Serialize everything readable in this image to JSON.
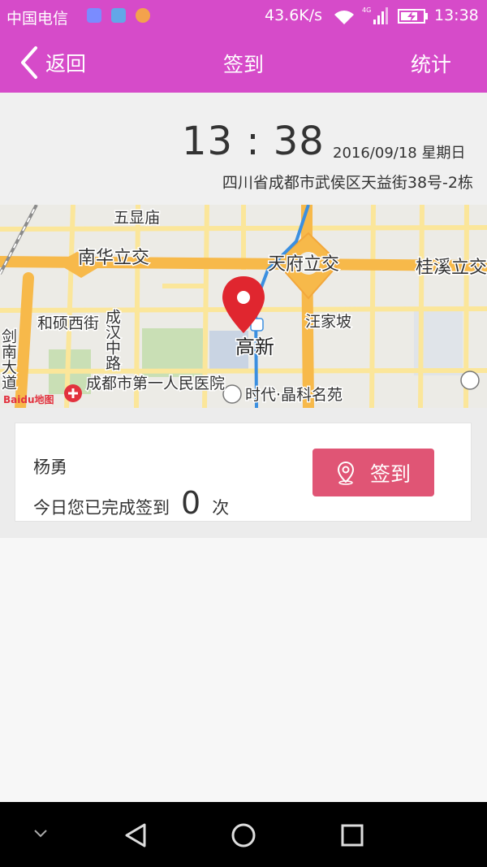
{
  "status_bar": {
    "carrier": "中国电信",
    "speed": "43.6K/s",
    "network": "4G",
    "time": "13:38"
  },
  "header": {
    "back_label": "返回",
    "title": "签到",
    "right_action": "统计"
  },
  "clock": {
    "time": "13 : 38",
    "date": "2016/09/18  星期日",
    "address": "四川省成都市武侯区天益街38号-2栋"
  },
  "map": {
    "labels": {
      "wuxianmiao": "五显庙",
      "nanhua": "南华立交",
      "tianfu": "天府立交",
      "guixi": "桂溪立交",
      "heshuo": "和硕西街",
      "chenghan": "成汉中路",
      "jiannan": "剑南大道",
      "wangjiapo": "汪家坡",
      "gaoxin": "高新",
      "hospital": "成都市第一人民医院",
      "shidai": "时代·晶科名苑",
      "baidu": "Baidu地图"
    },
    "colors": {
      "road_major": "#f7b94a",
      "road_minor": "#fbe69a",
      "metro": "#3b8fe0",
      "marker": "#e0262f"
    }
  },
  "signin": {
    "user": "杨勇",
    "done_prefix": "今日您已完成签到",
    "count": "0",
    "done_suffix": "次",
    "button_label": "签到"
  }
}
